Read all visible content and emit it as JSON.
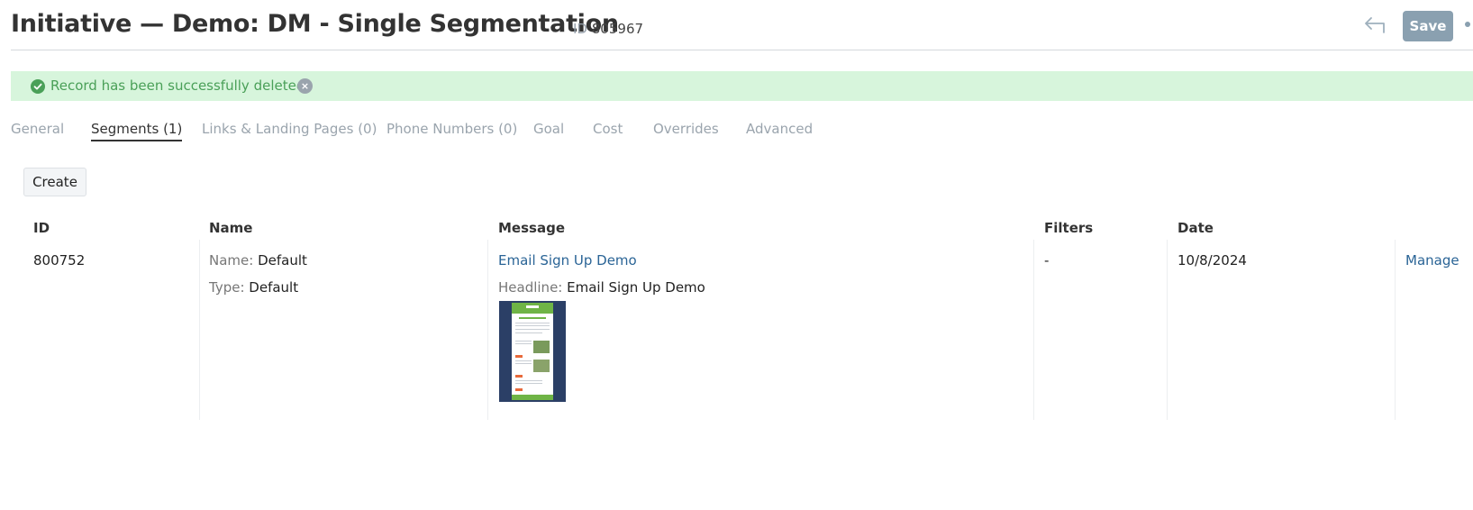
{
  "header": {
    "title": "Initiative — Demo: DM - Single Segmentation",
    "id_label": "ID",
    "id_value": "805967",
    "save_label": "Save"
  },
  "alert": {
    "message": "Record has been successfully deleted.",
    "close_symbol": "×",
    "color": "#4aa058"
  },
  "tabs": [
    {
      "label": "General",
      "active": false
    },
    {
      "label": "Segments (1)",
      "active": true
    },
    {
      "label": "Links & Landing Pages (0)",
      "active": false
    },
    {
      "label": "Phone Numbers (0)",
      "active": false
    },
    {
      "label": "Goal",
      "active": false
    },
    {
      "label": "Cost",
      "active": false
    },
    {
      "label": "Overrides",
      "active": false
    },
    {
      "label": "Advanced",
      "active": false
    }
  ],
  "actions": {
    "create_label": "Create"
  },
  "table": {
    "headers": [
      "ID",
      "Name",
      "Message",
      "Filters",
      "Date"
    ],
    "rows": [
      {
        "id": "800752",
        "name_label": "Name:",
        "name_value": "Default",
        "type_label": "Type:",
        "type_value": "Default",
        "message_link": "Email Sign Up Demo",
        "headline_label": "Headline:",
        "headline_value": "Email Sign Up Demo",
        "filters": "-",
        "date": "10/8/2024",
        "manage_label": "Manage"
      }
    ]
  },
  "colors": {
    "accent": "#8aa0b0",
    "link": "#2a6496",
    "alert_bg": "#d7f5dc"
  }
}
